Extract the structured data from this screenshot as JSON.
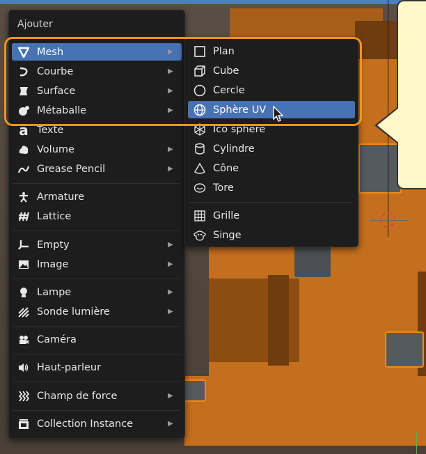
{
  "menu": {
    "title": "Ajouter",
    "items": [
      {
        "label": "Mesh",
        "icon": "mesh-triangle-icon",
        "submenu": true,
        "active": true
      },
      {
        "label": "Courbe",
        "icon": "curve-icon",
        "submenu": true
      },
      {
        "label": "Surface",
        "icon": "surface-icon",
        "submenu": true
      },
      {
        "label": "Métaballe",
        "icon": "metaball-icon",
        "submenu": true
      },
      {
        "label": "Texte",
        "icon": "text-icon",
        "submenu": false
      },
      {
        "label": "Volume",
        "icon": "volume-icon",
        "submenu": true
      },
      {
        "label": "Grease Pencil",
        "icon": "grease-pencil-icon",
        "submenu": true
      },
      {
        "label": "Armature",
        "icon": "armature-icon",
        "submenu": false
      },
      {
        "label": "Lattice",
        "icon": "lattice-icon",
        "submenu": false
      },
      {
        "label": "Empty",
        "icon": "empty-icon",
        "submenu": true
      },
      {
        "label": "Image",
        "icon": "image-icon",
        "submenu": true
      },
      {
        "label": "Lampe",
        "icon": "lamp-icon",
        "submenu": true
      },
      {
        "label": "Sonde lumière",
        "icon": "light-probe-icon",
        "submenu": true
      },
      {
        "label": "Caméra",
        "icon": "camera-icon",
        "submenu": false
      },
      {
        "label": "Haut-parleur",
        "icon": "speaker-icon",
        "submenu": false
      },
      {
        "label": "Champ de force",
        "icon": "force-field-icon",
        "submenu": true
      },
      {
        "label": "Collection Instance",
        "icon": "collection-instance-icon",
        "submenu": true
      }
    ]
  },
  "submenu": {
    "items": [
      {
        "label": "Plan",
        "icon": "plane-icon"
      },
      {
        "label": "Cube",
        "icon": "cube-icon"
      },
      {
        "label": "Cercle",
        "icon": "circle-icon"
      },
      {
        "label": "Sphère UV",
        "icon": "uv-sphere-icon",
        "active": true
      },
      {
        "label": "Ico sphère",
        "icon": "ico-sphere-icon"
      },
      {
        "label": "Cylindre",
        "icon": "cylinder-icon"
      },
      {
        "label": "Cône",
        "icon": "cone-icon"
      },
      {
        "label": "Tore",
        "icon": "torus-icon"
      },
      {
        "label": "Grille",
        "icon": "grid-icon"
      },
      {
        "label": "Singe",
        "icon": "monkey-icon"
      }
    ]
  },
  "colors": {
    "accent": "#4772b3",
    "highlight_outline": "#f2921f",
    "menu_bg": "#1d1d1d",
    "callout_bg": "#fff8c8"
  }
}
